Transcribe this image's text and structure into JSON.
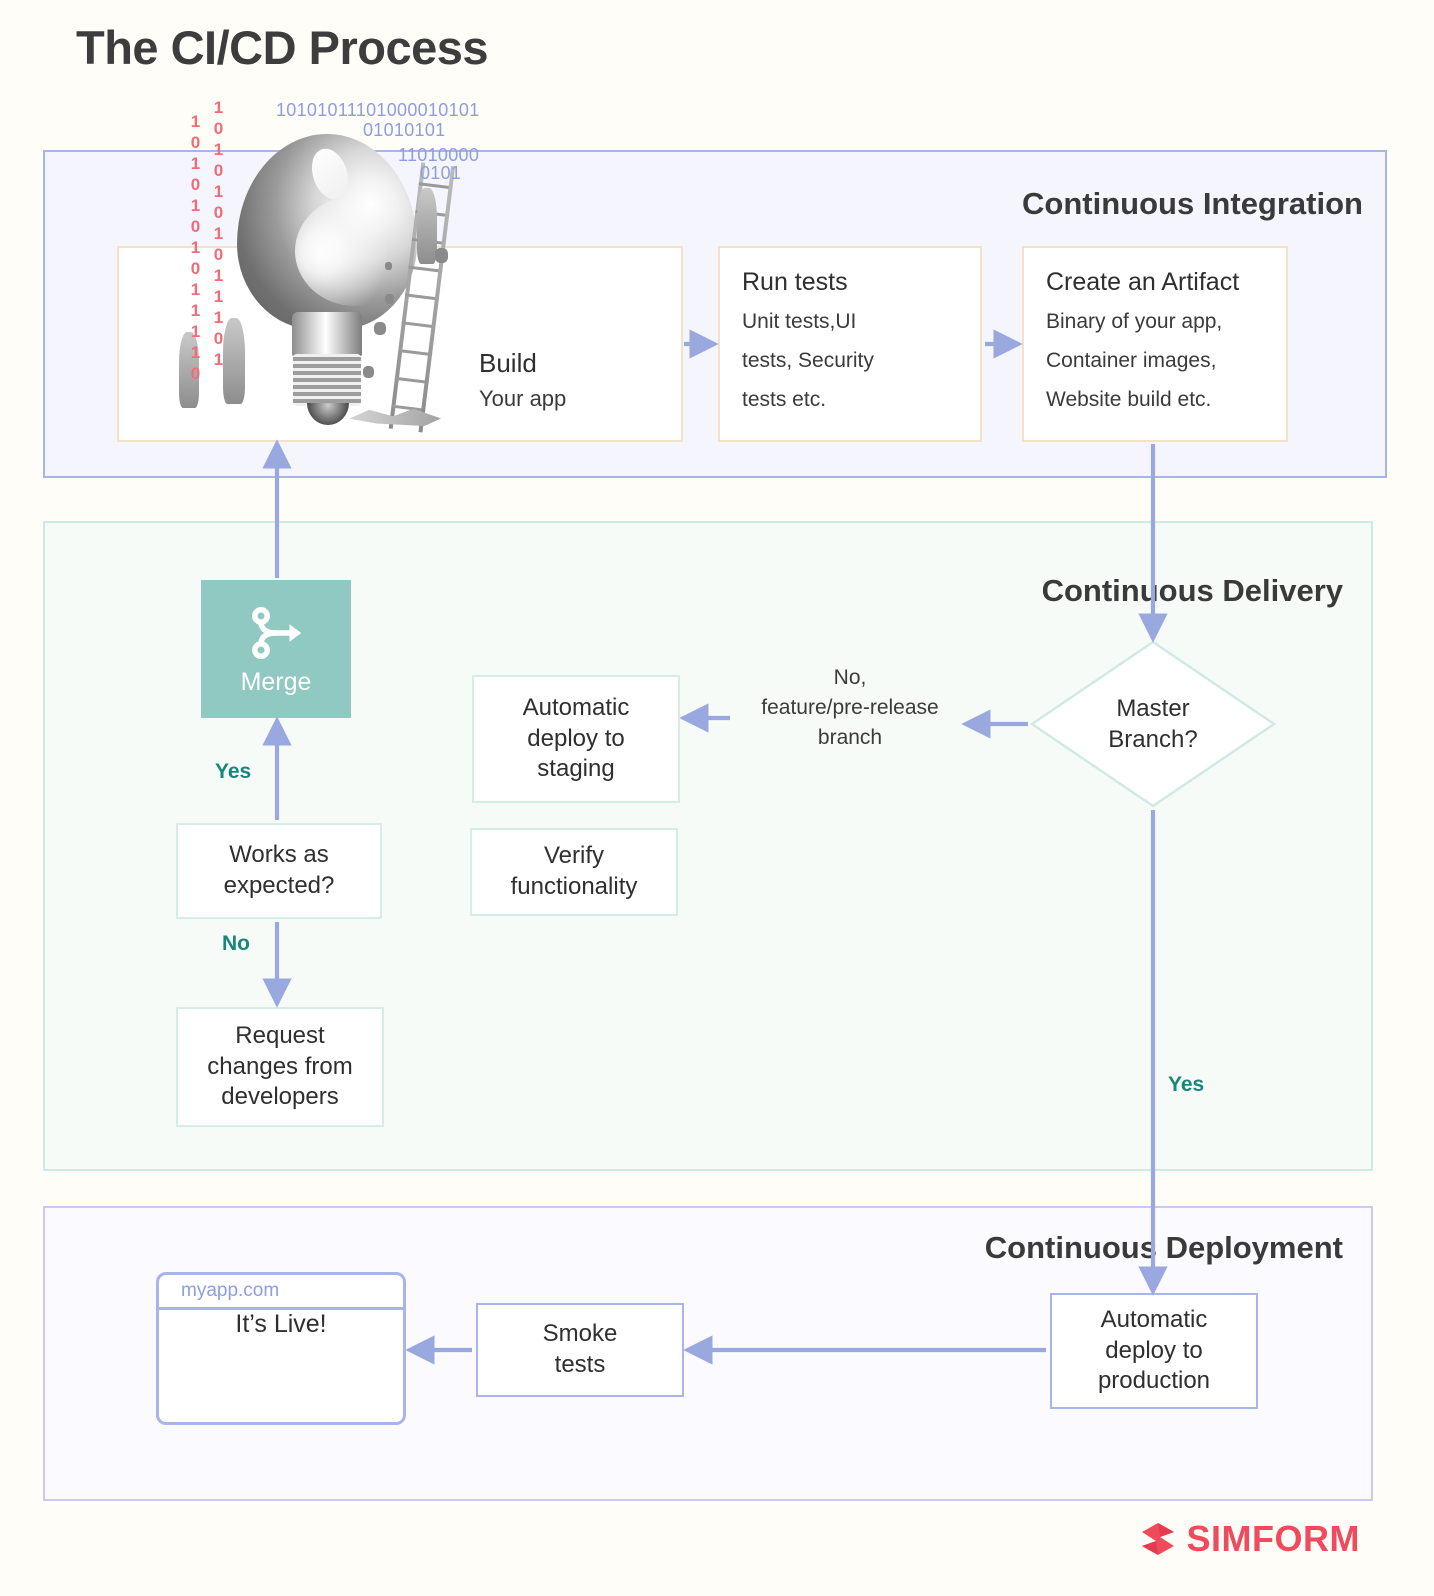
{
  "page": {
    "title": "The CI/CD Process",
    "background_color": "#fffdf7"
  },
  "illustration": {
    "binary_column_left": "1010101011110",
    "binary_column_right": "1010101011101",
    "binary_row_1": "10101011101000010101",
    "binary_row_2": "01010101",
    "binary_row_3": "11010000",
    "binary_row_4": "0101",
    "binary_red_color": "#f46b78",
    "binary_blue_color": "#8d9ee0"
  },
  "sections": {
    "ci": {
      "title": "Continuous Integration",
      "border_color": "#a9b5ea",
      "fill_color": "#f5f6fd",
      "boxes": [
        {
          "id": "build",
          "head": "Build",
          "sub": "Your app",
          "border_color": "#f3e2c6"
        },
        {
          "id": "run-tests",
          "head": "Run tests",
          "sub_lines": [
            "Unit tests,UI",
            "tests, Security",
            "tests etc."
          ],
          "border_color": "#f3e2c6"
        },
        {
          "id": "create-artifact",
          "head": "Create an Artifact",
          "sub_lines": [
            "Binary of your app,",
            "Container images,",
            "Website build etc."
          ],
          "border_color": "#f3e2c6"
        }
      ]
    },
    "continuous_delivery": {
      "title": "Continuous Delivery",
      "border_color": "#cfeae4",
      "fill_color": "#f6fbf8",
      "merge": {
        "label": "Merge",
        "icon": "git-merge-icon",
        "fill_color": "#8fc9c1"
      },
      "decision": {
        "label": "Master Branch?",
        "line1": "Master",
        "line2": "Branch?",
        "border_color": "#cfeae4"
      },
      "branch_label": {
        "line1": "No,",
        "line2": "feature/pre-release",
        "line3": "branch"
      },
      "boxes": [
        {
          "id": "automatic-deploy-staging",
          "lines": [
            "Automatic",
            "deploy to",
            "staging"
          ]
        },
        {
          "id": "verify-functionality",
          "lines": [
            "Verify",
            "functionality"
          ]
        },
        {
          "id": "works-as-expected",
          "lines": [
            "Works as",
            "expected?"
          ]
        },
        {
          "id": "request-changes",
          "lines": [
            "Request",
            "changes from",
            "developers"
          ]
        }
      ],
      "flow_labels": {
        "yes_merge": "Yes",
        "no_request": "No",
        "yes_production": "Yes"
      },
      "flow_label_color": "#18867b"
    },
    "continuous_deployment": {
      "title": "Continuous Deployment",
      "border_color": "#cdc7f6",
      "fill_color": "#fafaff",
      "boxes": [
        {
          "id": "automatic-deploy-production",
          "lines": [
            "Automatic",
            "deploy to",
            "production"
          ]
        },
        {
          "id": "smoke-tests",
          "lines": [
            "Smoke",
            "tests"
          ]
        }
      ],
      "browser": {
        "url": "myapp.com",
        "message": "It’s Live!",
        "border_color": "#a9b5ea"
      }
    }
  },
  "branding": {
    "name": "SIMFORM",
    "color": "#ef4b5d",
    "icon": "simform-logo-icon"
  },
  "theme": {
    "arrow_color": "#9aa8e0",
    "text_color": "#2f2f2f"
  }
}
